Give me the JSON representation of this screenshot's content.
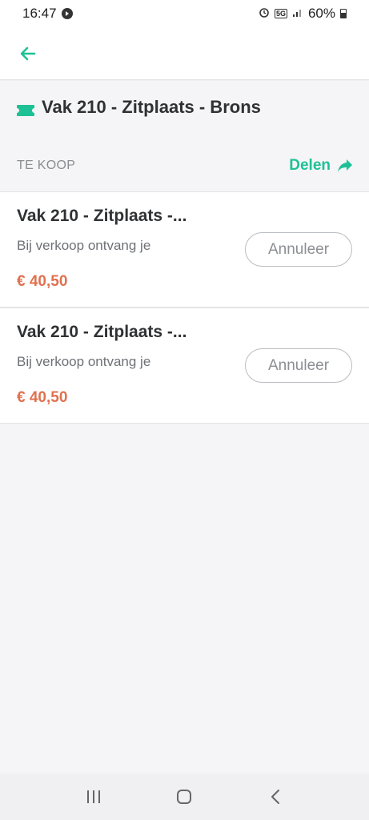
{
  "status_bar": {
    "time": "16:47",
    "network": "5G",
    "battery": "60%"
  },
  "app_bar": {
    "back_icon": "arrow-left-icon"
  },
  "ticket": {
    "title": "Vak 210 - Zitplaats - Brons",
    "icon": "ticket-icon"
  },
  "section": {
    "label": "TE KOOP",
    "share_label": "Delen",
    "share_icon": "share-arrow-icon"
  },
  "listings": [
    {
      "name": "Vak 210 - Zitplaats -...",
      "subtitle": "Bij verkoop ontvang je",
      "price": "€ 40,50",
      "cancel_label": "Annuleer"
    },
    {
      "name": "Vak 210 - Zitplaats -...",
      "subtitle": "Bij verkoop ontvang je",
      "price": "€ 40,50",
      "cancel_label": "Annuleer"
    }
  ],
  "colors": {
    "accent": "#1ec196",
    "price": "#e0714f"
  },
  "nav_bar": {
    "recents_icon": "recents-icon",
    "home_icon": "home-icon",
    "back_icon": "back-chevron-icon"
  }
}
